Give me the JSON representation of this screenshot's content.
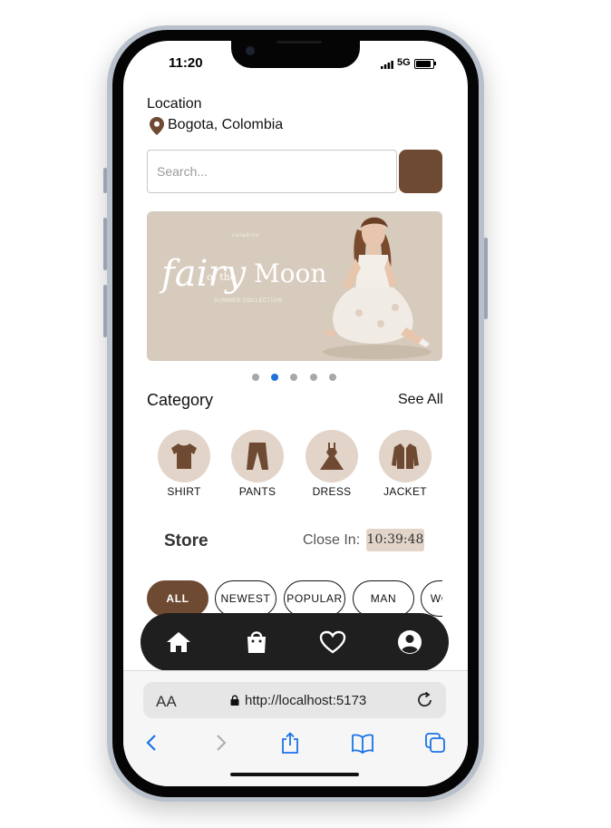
{
  "status_bar": {
    "time": "11:20",
    "network": "5G"
  },
  "location": {
    "label": "Location",
    "value": "Bogota, Colombia"
  },
  "search": {
    "placeholder": "Search..."
  },
  "banner": {
    "brand": "caladino",
    "title_part1": "fairy",
    "title_part2": "of the",
    "title_part3": "Moon",
    "subtitle": "SUMMER COLLECTION",
    "slide_count": 5,
    "active_slide": 2
  },
  "category": {
    "title": "Category",
    "see_all": "See All",
    "items": [
      {
        "label": "SHIRT",
        "icon": "shirt-icon"
      },
      {
        "label": "PANTS",
        "icon": "pants-icon"
      },
      {
        "label": "DRESS",
        "icon": "dress-icon"
      },
      {
        "label": "JACKET",
        "icon": "jacket-icon"
      }
    ]
  },
  "store": {
    "title": "Store",
    "close_label": "Close In:",
    "timer": "10:39:48"
  },
  "filters": [
    {
      "label": "ALL",
      "active": true
    },
    {
      "label": "NEWEST",
      "active": false
    },
    {
      "label": "POPULAR",
      "active": false
    },
    {
      "label": "MAN",
      "active": false
    },
    {
      "label": "WOMAN",
      "active": false
    }
  ],
  "bottom_nav": [
    {
      "icon": "home-icon"
    },
    {
      "icon": "shopping-bag-icon"
    },
    {
      "icon": "heart-icon"
    },
    {
      "icon": "user-icon"
    }
  ],
  "browser": {
    "aa_label": "AA",
    "url": "http://localhost:5173",
    "toolbar": [
      "back-icon",
      "forward-icon",
      "share-icon",
      "bookmarks-icon",
      "tabs-icon"
    ]
  },
  "colors": {
    "accent": "#6f4a33",
    "category_bg": "#e2d4c8",
    "nav_bg": "#1f1f1f",
    "dot_active": "#1e72d8"
  }
}
